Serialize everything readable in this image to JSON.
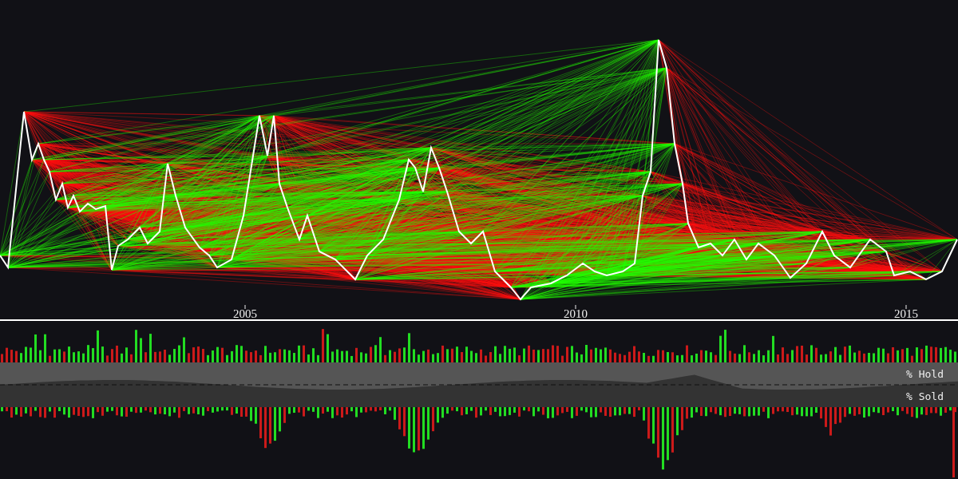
{
  "price_chart": {
    "x_axis_labels": [
      "2005",
      "2010",
      "2015"
    ]
  },
  "ownership_panel": {
    "labels": [
      "% Hold",
      "% Sold"
    ]
  }
}
